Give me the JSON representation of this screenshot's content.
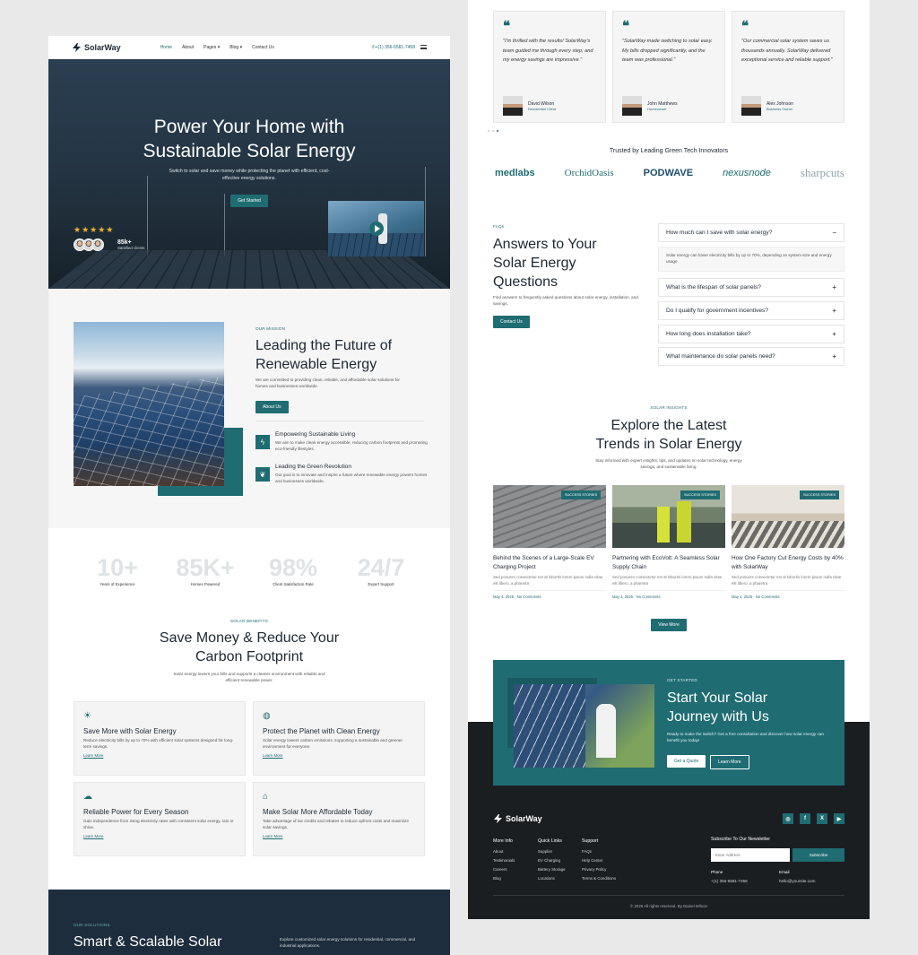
{
  "left": {
    "nav": {
      "brand": "SolarWay",
      "links": [
        "Home",
        "About",
        "Pages",
        "Blog",
        "Contact Us"
      ],
      "phone": "+(1) 356-6581-7458"
    },
    "hero": {
      "title_line1": "Power Your Home with",
      "title_line2": "Sustainable Solar Energy",
      "subtitle": "Switch to solar and save money while protecting the planet with efficient, cost-effective energy solutions.",
      "cta": "Get Started",
      "rating_stars": 5,
      "clients_count": "85k+",
      "clients_label": "Satisfied clients"
    },
    "mission": {
      "label": "OUR MISSION",
      "title_line1": "Leading the Future of",
      "title_line2": "Renewable Energy",
      "desc": "We are committed to providing clean, reliable, and affordable solar solutions for homes and businesses worldwide.",
      "button": "About Us",
      "features": [
        {
          "title": "Empowering Sustainable Living",
          "desc": "We aim to make clean energy accessible, reducing carbon footprints and promoting eco-friendly lifestyles."
        },
        {
          "title": "Leading the Green Revolution",
          "desc": "Our goal is to innovate and inspire a future where renewable energy powers homes and businesses worldwide."
        }
      ]
    },
    "stats": [
      {
        "value": "10+",
        "label": "Years of Experience"
      },
      {
        "value": "85K+",
        "label": "Homes Powered"
      },
      {
        "value": "98%",
        "label": "Client Satisfaction Rate"
      },
      {
        "value": "24/7",
        "label": "Expert Support"
      }
    ],
    "benefits": {
      "label": "SOLAR BENEFITS",
      "title_line1": "Save Money & Reduce Your",
      "title_line2": "Carbon Footprint",
      "desc": "Solar energy lowers your bills and supports a cleaner environment with reliable and efficient renewable power.",
      "cards": [
        {
          "title": "Save More with Solar Energy",
          "desc": "Reduce electricity bills by up to 70% with efficient solar systems designed for long-term savings.",
          "link": "Learn More"
        },
        {
          "title": "Protect the Planet with Clean Energy",
          "desc": "Solar energy lowers carbon emissions, supporting a sustainable and greener environment for everyone.",
          "link": "Learn More"
        },
        {
          "title": "Reliable Power for Every Season",
          "desc": "Gain independence from rising electricity rates with consistent solar energy, rain or shine.",
          "link": "Learn More"
        },
        {
          "title": "Make Solar More Affordable Today",
          "desc": "Take advantage of tax credits and rebates to reduce upfront costs and maximize solar savings.",
          "link": "Learn More"
        }
      ]
    },
    "solutions": {
      "label": "OUR SOLUTIONS",
      "title": "Smart & Scalable Solar",
      "desc": "Explore customized solar energy solutions for residential, commercial, and industrial applications."
    }
  },
  "right": {
    "testimonials": [
      {
        "quote": "\"I'm thrilled with the results! SolarWay's team guided me through every step, and my energy savings are impressive.\"",
        "name": "David Wilson",
        "role": "Residential Client"
      },
      {
        "quote": "\"SolarWay made switching to solar easy. My bills dropped significantly, and the team was professional.\"",
        "name": "John Matthews",
        "role": "Homeowner"
      },
      {
        "quote": "\"Our commercial solar system saves us thousands annually. SolarWay delivered exceptional service and reliable support.\"",
        "name": "Alex Johnson",
        "role": "Business Owner"
      }
    ],
    "trusted": {
      "title": "Trusted by Leading Green Tech Innovators",
      "brands": [
        "medlabs",
        "OrchidOasis",
        "PODWAVE",
        "nexusnode",
        "sharpcuts"
      ]
    },
    "faq": {
      "label": "FAQs",
      "title_line1": "Answers to Your",
      "title_line2": "Solar Energy",
      "title_line3": "Questions",
      "desc": "Find answers to frequently asked questions about solar energy, installation, and savings.",
      "button": "Contact Us",
      "items": [
        {
          "q": "How much can I save with solar energy?",
          "a": "Solar energy can lower electricity bills by up to 70%, depending on system size and energy usage.",
          "open": true
        },
        {
          "q": "What is the lifespan of solar panels?",
          "open": false
        },
        {
          "q": "Do I qualify for government incentives?",
          "open": false
        },
        {
          "q": "How long does installation take?",
          "open": false
        },
        {
          "q": "What maintenance do solar panels need?",
          "open": false
        }
      ]
    },
    "insights": {
      "label": "SOLAR INSIGHTS",
      "title_line1": "Explore the Latest",
      "title_line2": "Trends in Solar Energy",
      "desc": "Stay informed with expert insights, tips, and updates on solar technology, energy savings, and sustainable living.",
      "button": "View More",
      "posts": [
        {
          "tag": "SUCCESS STORIES",
          "title": "Behind the Scenes of a Large-Scale EV Charging Project",
          "excerpt": "Sed posuere consectetur est at lobortis lorem ipsum nulla vitae elit libero, a pharetra",
          "date": "May 4, 2025",
          "comments": "No Comments"
        },
        {
          "tag": "SUCCESS STORIES",
          "title": "Partnering with EcoVolt: A Seamless Solar Supply Chain",
          "excerpt": "Sed posuere consectetur est at lobortis lorem ipsum nulla vitae elit libero, a pharetra",
          "date": "May 4, 2025",
          "comments": "No Comments"
        },
        {
          "tag": "SUCCESS STORIES",
          "title": "How One Factory Cut Energy Costs by 40% with SolarWay",
          "excerpt": "Sed posuere consectetur est at lobortis lorem ipsum nulla vitae elit libero, a pharetra",
          "date": "May 4, 2025",
          "comments": "No Comments"
        }
      ]
    },
    "cta": {
      "label": "GET STARTED",
      "title_line1": "Start Your Solar",
      "title_line2": "Journey with Us",
      "desc": "Ready to make the switch? Get a free consultation and discover how solar energy can benefit you today!",
      "btn1": "Get a Quote",
      "btn2": "Learn More"
    },
    "footer": {
      "brand": "SolarWay",
      "cols": [
        {
          "title": "More Info",
          "items": [
            "About",
            "Testimonials",
            "Careers",
            "Blog"
          ]
        },
        {
          "title": "Quick Links",
          "items": [
            "Supplier",
            "EV Charging",
            "Battery Storage",
            "Locations"
          ]
        },
        {
          "title": "Support",
          "items": [
            "FAQs",
            "Help Center",
            "Privacy Policy",
            "Terms & Conditions"
          ]
        }
      ],
      "newsletter_title": "Subscribe To Our Newsletter",
      "email_placeholder": "Enter Address",
      "subscribe": "Subscribe",
      "phone_label": "Phone",
      "phone": "+(1) 356-6581-7458",
      "email_label": "Email",
      "email": "hello@yoursite.com",
      "copyright": "© 2025 All rights reserved. By Daniel Wilson",
      "social": [
        "instagram-icon",
        "facebook-icon",
        "x-icon",
        "youtube-icon"
      ]
    }
  },
  "colors": {
    "accent": "#1f6c72",
    "dark": "#1e2d3d",
    "footer": "#1b1e21",
    "star": "#f2b32b"
  }
}
